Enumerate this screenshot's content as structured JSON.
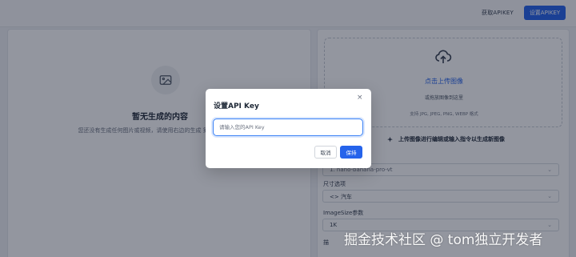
{
  "header": {
    "get_key_label": "获取APIKEY",
    "set_key_label": "设置APIKEY"
  },
  "left": {
    "empty_title": "暂无生成的内容",
    "empty_desc": "您还没有生成任何图片或视频，请使用右边的生成 第一个AI内容。"
  },
  "right": {
    "upload_title": "点击上传图像",
    "upload_sub": "或拖放图像到这里",
    "upload_formats": "支持 JPG, JPEG, PNG, WEBP 格式",
    "hint": "上传图像进行编辑或输入指令以生成新图像",
    "model_value": "1. nano-banana-pro-vt",
    "size_label": "尺寸选项",
    "size_value": "<> 汽车",
    "imagesize_label": "ImageSize参数",
    "imagesize_value": "1K",
    "extra_label": "描"
  },
  "modal": {
    "title": "设置API Key",
    "close_glyph": "×",
    "input_placeholder": "请输入您的API Key",
    "input_value": "",
    "cancel_label": "取消",
    "save_label": "保持"
  },
  "watermark": "掘金技术社区 @ tom独立开发者",
  "colors": {
    "primary": "#2563eb",
    "overlay": "rgba(15,23,42,0.45)"
  },
  "icons": {
    "empty_state": "image-icon",
    "upload": "upload-icon",
    "hint": "sparkle-icon",
    "close": "close-icon",
    "chevron": "chevron-down-icon"
  }
}
